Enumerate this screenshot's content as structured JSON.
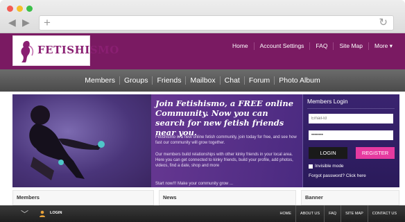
{
  "site": {
    "logo_text": "FETISHISMO",
    "top_nav": [
      "Home",
      "Account Settings",
      "FAQ",
      "Site Map",
      "More ▾"
    ],
    "main_nav": [
      "Members",
      "Groups",
      "Friends",
      "Mailbox",
      "Chat",
      "Forum",
      "Photo Album"
    ],
    "banner": {
      "headline": "Join Fetishismo, a FREE online Community. Now you can search for new fetish friends near you.",
      "para1": "Fetishismo is a new online fetish community, join today for free, and see how fast our community will grow together.",
      "para2": "Our members build relationships with other kinky friends in your local area. Here you can get connected to kinky friends, build your profile, add photos, videos, find a date, shop and more",
      "para3": "Start now!!! Make your community grow ..."
    },
    "login": {
      "title": "Members Login",
      "email_placeholder": "Email-Id",
      "password_value": "••••••••",
      "login_label": "LOGIN",
      "register_label": "REGISTER",
      "invisible_label": "Invisible mode",
      "forgot_label": "Forgot password? Click here"
    },
    "sections": [
      "Members",
      "News",
      "Banner"
    ],
    "bottom_bar": {
      "login_label": "LOGIN",
      "links": [
        "HOME",
        "ABOUT US",
        "FAQ",
        "SITE MAP",
        "CONTACT US"
      ]
    }
  },
  "colors": {
    "header": "#7a1a62",
    "accent": "#e63aa0",
    "banner": "#5a2a7e"
  }
}
